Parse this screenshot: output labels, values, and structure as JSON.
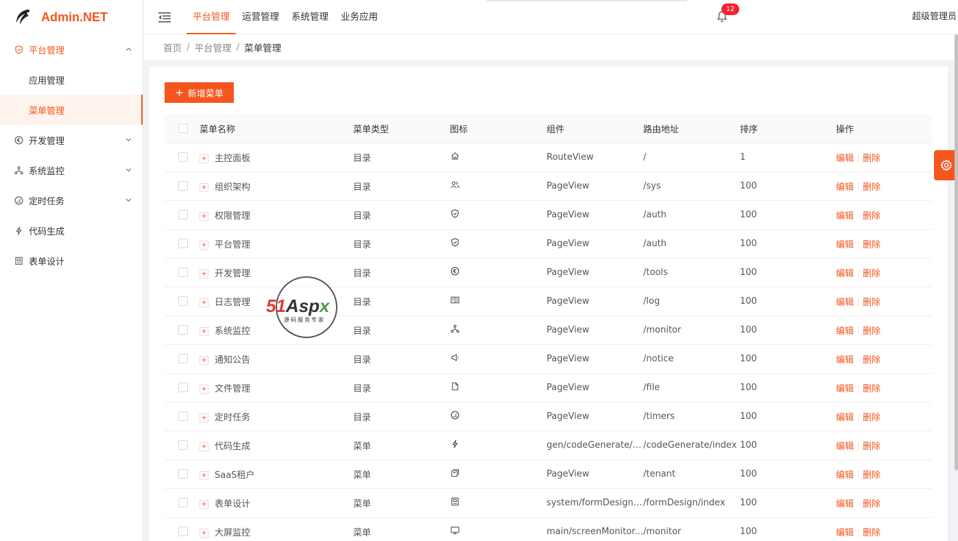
{
  "brand": {
    "name": "Admin.NET"
  },
  "header": {
    "nav": [
      "平台管理",
      "运营管理",
      "系统管理",
      "业务应用"
    ],
    "active_nav": 0,
    "notification_count": "12",
    "user_name": "超级管理员"
  },
  "breadcrumb": [
    "首页",
    "平台管理",
    "菜单管理"
  ],
  "sidebar": {
    "items": [
      {
        "label": "平台管理",
        "icon": "shield-icon",
        "expanded": true
      },
      {
        "label": "应用管理"
      },
      {
        "label": "菜单管理",
        "selected": true
      },
      {
        "label": "开发管理",
        "icon": "euro-icon"
      },
      {
        "label": "系统监控",
        "icon": "cluster-icon"
      },
      {
        "label": "定时任务",
        "icon": "dashboard-icon"
      },
      {
        "label": "代码生成",
        "icon": "lightning-icon"
      },
      {
        "label": "表单设计",
        "icon": "form-icon"
      }
    ]
  },
  "toolbar": {
    "add_label": "新增菜单"
  },
  "table": {
    "columns": [
      "菜单名称",
      "菜单类型",
      "图标",
      "组件",
      "路由地址",
      "排序",
      "操作"
    ],
    "edit_label": "编辑",
    "delete_label": "删除",
    "rows": [
      {
        "name": "主控面板",
        "type": "目录",
        "icon": "home-icon",
        "component": "RouteView",
        "path": "/",
        "sort": "1"
      },
      {
        "name": "组织架构",
        "type": "目录",
        "icon": "team-icon",
        "component": "PageView",
        "path": "/sys",
        "sort": "100"
      },
      {
        "name": "权限管理",
        "type": "目录",
        "icon": "shield-icon",
        "component": "PageView",
        "path": "/auth",
        "sort": "100"
      },
      {
        "name": "平台管理",
        "type": "目录",
        "icon": "shield-icon",
        "component": "PageView",
        "path": "/auth",
        "sort": "100"
      },
      {
        "name": "开发管理",
        "type": "目录",
        "icon": "euro-icon",
        "component": "PageView",
        "path": "/tools",
        "sort": "100"
      },
      {
        "name": "日志管理",
        "type": "目录",
        "icon": "log-icon",
        "component": "PageView",
        "path": "/log",
        "sort": "100"
      },
      {
        "name": "系统监控",
        "type": "目录",
        "icon": "cluster-icon",
        "component": "PageView",
        "path": "/monitor",
        "sort": "100"
      },
      {
        "name": "通知公告",
        "type": "目录",
        "icon": "sound-icon",
        "component": "PageView",
        "path": "/notice",
        "sort": "100"
      },
      {
        "name": "文件管理",
        "type": "目录",
        "icon": "file-icon",
        "component": "PageView",
        "path": "/file",
        "sort": "100"
      },
      {
        "name": "定时任务",
        "type": "目录",
        "icon": "dashboard-icon",
        "component": "PageView",
        "path": "/timers",
        "sort": "100"
      },
      {
        "name": "代码生成",
        "type": "菜单",
        "icon": "lightning-icon",
        "component": "gen/codeGenerate/i...",
        "path": "/codeGenerate/index",
        "sort": "100"
      },
      {
        "name": "SaaS租户",
        "type": "菜单",
        "icon": "switcher-icon",
        "component": "PageView",
        "path": "/tenant",
        "sort": "100"
      },
      {
        "name": "表单设计",
        "type": "菜单",
        "icon": "form-icon",
        "component": "system/formDesign/...",
        "path": "/formDesign/index",
        "sort": "100"
      },
      {
        "name": "大屏监控",
        "type": "菜单",
        "icon": "desktop-icon",
        "component": "main/screenMonitor...",
        "path": "/monitor",
        "sort": "100"
      }
    ]
  },
  "watermark": {
    "brand_parts": [
      "51",
      "Asp",
      "x"
    ],
    "tagline": "源码服务专家"
  },
  "colors": {
    "accent": "#f5561e",
    "badge": "#f5222d"
  }
}
